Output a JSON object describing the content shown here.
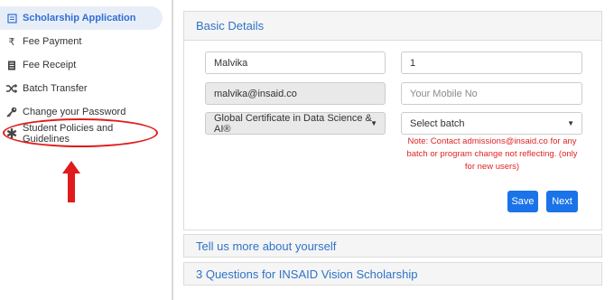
{
  "sidebar": {
    "items": [
      {
        "label": "Scholarship Application",
        "icon": "form-icon"
      },
      {
        "label": "Fee Payment",
        "icon": "rupee-icon"
      },
      {
        "label": "Fee Receipt",
        "icon": "receipt-icon"
      },
      {
        "label": "Batch Transfer",
        "icon": "shuffle-icon"
      },
      {
        "label": "Change your Password",
        "icon": "key-icon"
      },
      {
        "label": "Student Policies and Guidelines",
        "icon": "asterisk-icon"
      }
    ]
  },
  "annotation": {
    "color": "#e01b1b"
  },
  "basic_details": {
    "title": "Basic Details",
    "name_value": "Malvika",
    "number_value": "1",
    "email_value": "malvika@insaid.co",
    "mobile_placeholder": "Your Mobile No",
    "program_selected": "Global Certificate in Data Science & AI®",
    "batch_selected": "Select batch",
    "note": "Note: Contact admissions@insaid.co for any batch or program change not reflecting. (only for new users)",
    "save_label": "Save",
    "next_label": "Next"
  },
  "sections": [
    {
      "label": "Tell us more about yourself"
    },
    {
      "label": "3 Questions for INSAID Vision Scholarship"
    }
  ],
  "colors": {
    "accent": "#1a73e8",
    "link": "#2f73c6",
    "note": "#e02424"
  }
}
